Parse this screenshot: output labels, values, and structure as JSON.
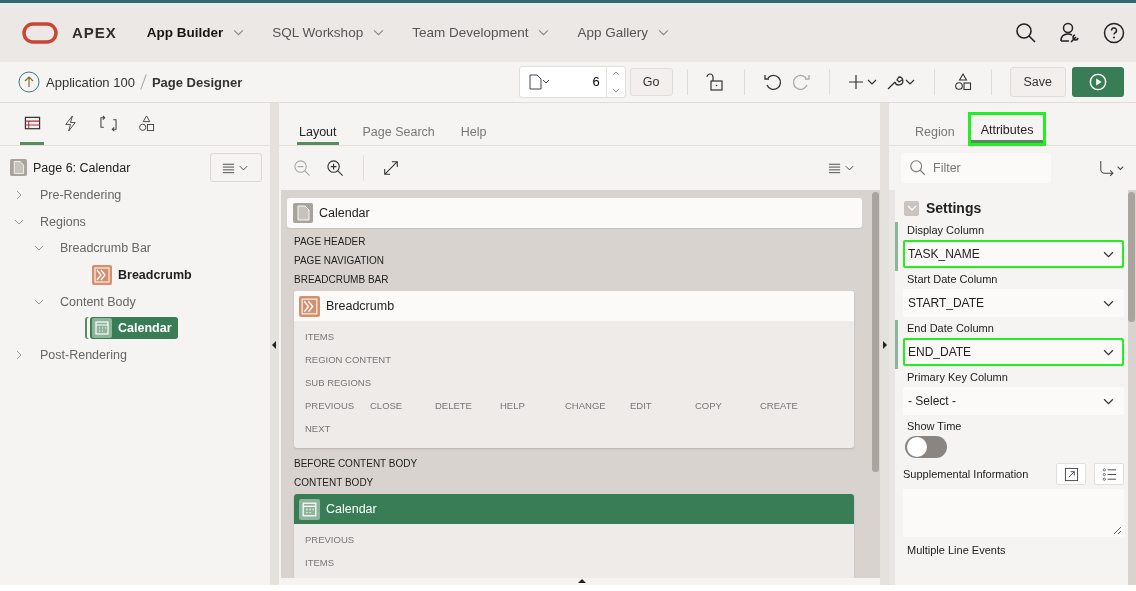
{
  "header": {
    "logo": "APEX",
    "nav": [
      {
        "label": "App Builder",
        "selected": true
      },
      {
        "label": "SQL Workshop",
        "selected": false
      },
      {
        "label": "Team Development",
        "selected": false
      },
      {
        "label": "App Gallery",
        "selected": false
      }
    ]
  },
  "toolbar": {
    "breadcrumb": [
      "Application 100",
      "Page Designer"
    ],
    "page_number": "6",
    "go": "Go",
    "save": "Save"
  },
  "left_panel": {
    "tabs": [
      {
        "kind": "rendering",
        "selected": true
      },
      {
        "kind": "dynamic-actions",
        "selected": false
      },
      {
        "kind": "processing",
        "selected": false
      },
      {
        "kind": "shared",
        "selected": false
      }
    ],
    "page": "Page 6: Calendar",
    "tree": [
      {
        "kind": "folder",
        "label": "Pre-Rendering",
        "expanded": false
      },
      {
        "kind": "folder",
        "label": "Regions",
        "expanded": true,
        "children": [
          {
            "kind": "folder",
            "label": "Breadcrumb Bar",
            "expanded": true,
            "children": [
              {
                "label": "Breadcrumb",
                "kind": "breadcrumb",
                "selected": false
              }
            ]
          },
          {
            "kind": "folder",
            "label": "Content Body",
            "expanded": true,
            "children": [
              {
                "label": "Calendar",
                "kind": "calendar",
                "selected": true
              }
            ]
          }
        ]
      },
      {
        "kind": "folder",
        "label": "Post-Rendering",
        "expanded": false
      }
    ]
  },
  "middle": {
    "tabs": [
      {
        "label": "Layout",
        "selected": true
      },
      {
        "label": "Page Search",
        "selected": false
      },
      {
        "label": "Help",
        "selected": false
      }
    ],
    "page_title": "Calendar",
    "sections": [
      {
        "kind": "label",
        "text": "PAGE HEADER"
      },
      {
        "kind": "label",
        "text": "PAGE NAVIGATION"
      },
      {
        "kind": "label",
        "text": "BREADCRUMB BAR"
      },
      {
        "kind": "breadcrumb-region",
        "title": "Breadcrumb",
        "selected": false,
        "slots": [
          [
            "ITEMS"
          ],
          [
            "REGION CONTENT"
          ],
          [
            "SUB REGIONS"
          ],
          [
            "PREVIOUS",
            "CLOSE",
            "DELETE",
            "HELP",
            "CHANGE",
            "EDIT",
            "COPY",
            "CREATE"
          ],
          [
            "NEXT"
          ]
        ]
      },
      {
        "kind": "label",
        "text": "BEFORE CONTENT BODY"
      },
      {
        "kind": "label",
        "text": "CONTENT BODY"
      },
      {
        "kind": "calendar-region",
        "title": "Calendar",
        "selected": true,
        "slots": [
          [
            "PREVIOUS"
          ],
          [
            "ITEMS"
          ]
        ]
      }
    ]
  },
  "right_panel": {
    "tabs": [
      {
        "label": "Region",
        "selected": false,
        "highlighted": false
      },
      {
        "label": "Attributes",
        "selected": true,
        "highlighted": true
      }
    ],
    "filter": {
      "placeholder": "Filter"
    },
    "group": {
      "title": "Settings",
      "expanded": true
    },
    "properties": [
      {
        "kind": "select",
        "label": "Display Column",
        "value": "TASK_NAME",
        "changed": true,
        "highlighted": true
      },
      {
        "kind": "select",
        "label": "Start Date Column",
        "value": "START_DATE",
        "changed": false,
        "highlighted": false
      },
      {
        "kind": "select",
        "label": "End Date Column",
        "value": "END_DATE",
        "changed": true,
        "highlighted": true
      },
      {
        "kind": "select",
        "label": "Primary Key Column",
        "value": "- Select -",
        "changed": false,
        "highlighted": false
      },
      {
        "kind": "switch",
        "label": "Show Time",
        "on": false,
        "changed": false
      },
      {
        "kind": "textarea",
        "label": "Supplemental Information",
        "changed": false,
        "highlighted": false
      },
      {
        "kind": "heading",
        "label": "Multiple Line Events",
        "changed": false
      }
    ]
  }
}
